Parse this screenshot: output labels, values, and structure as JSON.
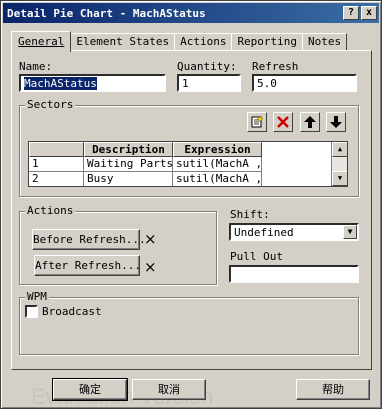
{
  "window": {
    "title": "Detail Pie Chart - MachAStatus",
    "help_icon": "?",
    "close_icon": "x"
  },
  "tabs": [
    {
      "label": "General",
      "active": true
    },
    {
      "label": "Element States",
      "active": false
    },
    {
      "label": "Actions",
      "active": false
    },
    {
      "label": "Reporting",
      "active": false
    },
    {
      "label": "Notes",
      "active": false
    }
  ],
  "general": {
    "name_label": "Name:",
    "name_value": "MachAStatus",
    "quantity_label": "Quantity:",
    "quantity_value": "1",
    "refresh_label": "Refresh",
    "refresh_value": "5.0"
  },
  "sectors": {
    "title": "Sectors",
    "columns": [
      "Description",
      "Expression"
    ],
    "rows": [
      {
        "num": "1",
        "description": "Waiting Parts",
        "expression": "sutil(MachA ,"
      },
      {
        "num": "2",
        "description": "Busy",
        "expression": "sutil(MachA ,"
      }
    ],
    "toolbar_icons": [
      "new-icon",
      "delete-icon",
      "move-up-icon",
      "move-down-icon"
    ]
  },
  "actions": {
    "title": "Actions",
    "before_refresh_label": "Before Refresh...",
    "after_refresh_label": "After Refresh...",
    "clear_icon": "×"
  },
  "shift": {
    "label": "Shift:",
    "value": "Undefined"
  },
  "pull_out": {
    "label": "Pull Out",
    "value": ""
  },
  "wpm": {
    "title": "WPM",
    "broadcast_label": "Broadcast",
    "broadcast_checked": false
  },
  "footer": {
    "ok_label": "确定",
    "cancel_label": "取消",
    "help_label": "帮助",
    "watermark": "Evaluation Version"
  },
  "colors": {
    "face": "#d4d0c8",
    "titlebar": "#0a246a",
    "selection": "#0a246a",
    "delete_red": "#cc0000"
  }
}
